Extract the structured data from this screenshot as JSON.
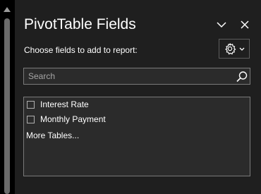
{
  "pane": {
    "title": "PivotTable Fields",
    "subtitle": "Choose fields to add to report:",
    "collapse_icon": "chevron-down-icon",
    "close_icon": "close-icon",
    "settings_icon": "gear-icon",
    "settings_dropdown_icon": "chevron-down-icon"
  },
  "search": {
    "placeholder": "Search",
    "value": "",
    "icon": "search-icon"
  },
  "fields": {
    "items": [
      {
        "label": "Interest Rate",
        "checked": false
      },
      {
        "label": "Monthly Payment",
        "checked": false
      }
    ],
    "more_tables_label": "More Tables..."
  },
  "colors": {
    "pane_background": "#1f1f1f",
    "list_background": "#2b2b2b",
    "border": "#7a7a7a",
    "text": "#ffffff"
  }
}
